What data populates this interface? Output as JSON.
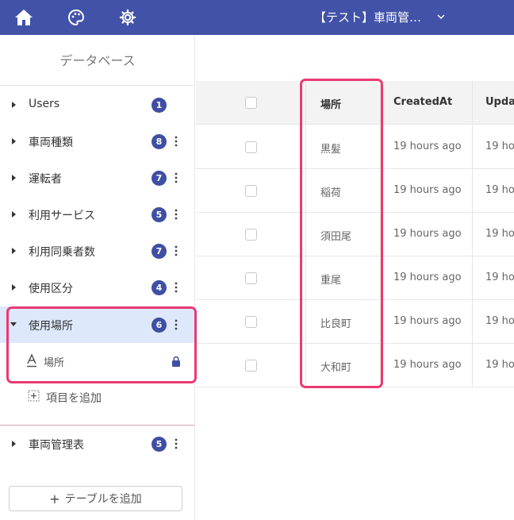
{
  "header": {
    "title": "【テスト】車両管…",
    "icons": [
      "home-icon",
      "palette-icon",
      "gear-icon",
      "chevron-down-icon"
    ],
    "color": "#4152a8"
  },
  "sidebar": {
    "title": "データベース",
    "items": [
      {
        "label": "Users",
        "count": "1"
      },
      {
        "label": "車両種類",
        "count": "8"
      },
      {
        "label": "運転者",
        "count": "7"
      },
      {
        "label": "利用サービス",
        "count": "5"
      },
      {
        "label": "利用同乗者数",
        "count": "7"
      },
      {
        "label": "使用区分",
        "count": "4"
      },
      {
        "label": "使用場所",
        "count": "6"
      }
    ],
    "active_field": {
      "label": "場所"
    },
    "add_field_label": "項目を追加",
    "extra_item": {
      "label": "車両管理表",
      "count": "5"
    },
    "add_table_label": "テーブルを追加"
  },
  "table": {
    "columns": [
      "場所",
      "CreatedAt",
      "Updat"
    ],
    "rows": [
      {
        "place": "黒髪",
        "created": "19 hours ago",
        "updated": "19 hou"
      },
      {
        "place": "稲荷",
        "created": "19 hours ago",
        "updated": "19 hou"
      },
      {
        "place": "須田尾",
        "created": "19 hours ago",
        "updated": "19 hou"
      },
      {
        "place": "重尾",
        "created": "19 hours ago",
        "updated": "19 hou"
      },
      {
        "place": "比良町",
        "created": "19 hours ago",
        "updated": "19 hou"
      },
      {
        "place": "大和町",
        "created": "19 hours ago",
        "updated": "19 hou"
      }
    ]
  },
  "colors": {
    "accent": "#3f4fa3",
    "highlight": "#ea3a72",
    "active_bg": "#dde9fb"
  }
}
